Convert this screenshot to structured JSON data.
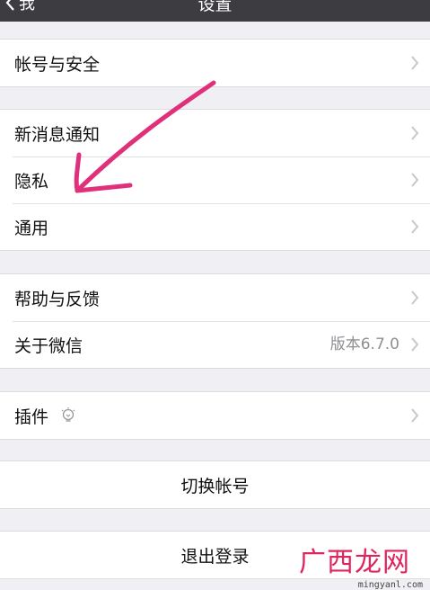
{
  "nav": {
    "back_label": "我",
    "title": "设置"
  },
  "groups": [
    {
      "items": [
        {
          "label": "帐号与安全"
        }
      ]
    },
    {
      "items": [
        {
          "label": "新消息通知"
        },
        {
          "label": "隐私"
        },
        {
          "label": "通用"
        }
      ]
    },
    {
      "items": [
        {
          "label": "帮助与反馈"
        },
        {
          "label": "关于微信",
          "value": "版本6.7.0"
        }
      ]
    },
    {
      "items": [
        {
          "label": "插件",
          "icon": "lightbulb-icon"
        }
      ]
    }
  ],
  "actions": {
    "switch_account": "切换帐号",
    "logout": "退出登录"
  },
  "annotation": {
    "color": "#e0307a"
  },
  "watermark": {
    "text": "广西龙网",
    "url": "mingyanl.com"
  }
}
